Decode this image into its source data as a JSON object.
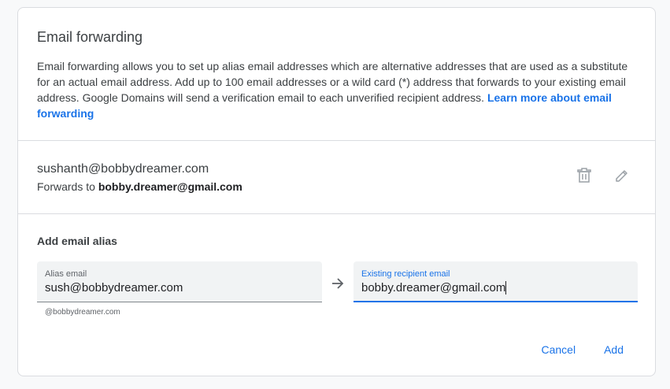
{
  "intro": {
    "title": "Email forwarding",
    "description": "Email forwarding allows you to set up alias email addresses which are alternative addresses that are used as a substitute for an actual email address. Add up to 100 email addresses or a wild card (*) address that forwards to your existing email address. Google Domains will send a verification email to each unverified recipient address. ",
    "learn_more": "Learn more about email forwarding"
  },
  "existing_alias": {
    "address": "sushanth@bobbydreamer.com",
    "forwards_label": "Forwards to ",
    "forwards_to": "bobby.dreamer@gmail.com",
    "delete_icon": "trash-icon",
    "edit_icon": "pencil-icon"
  },
  "add_alias": {
    "title": "Add email alias",
    "alias_field": {
      "label": "Alias email",
      "value": "sush@bobbydreamer.com",
      "helper": "@bobbydreamer.com"
    },
    "arrow_icon": "arrow-right-icon",
    "recipient_field": {
      "label": "Existing recipient email",
      "value": "bobby.dreamer@gmail.com"
    },
    "cancel_label": "Cancel",
    "add_label": "Add"
  },
  "colors": {
    "accent": "#1a73e8",
    "text": "#3c4043",
    "border": "#dadce0",
    "field_bg": "#f1f3f4"
  }
}
